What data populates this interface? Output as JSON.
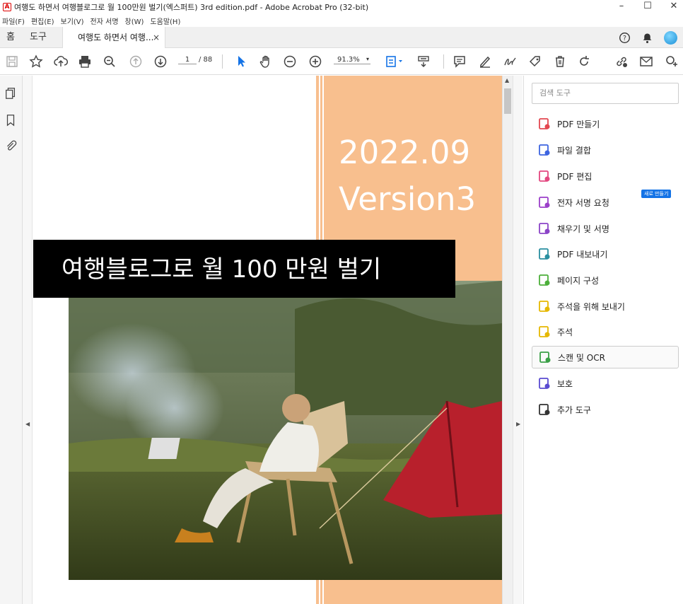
{
  "window": {
    "title": "여행도 하면서 여행블로그로 월 100만원 벌기(엑스퍼트) 3rd edition.pdf - Adobe Acrobat Pro (32-bit)",
    "app_icon": "pdf-icon",
    "controls": [
      "–",
      "☐",
      "✕"
    ]
  },
  "menu": [
    "파일(F)",
    "편집(E)",
    "보기(V)",
    "전자 서명",
    "창(W)",
    "도움말(H)"
  ],
  "tabs": {
    "home": "홈",
    "tools": "도구",
    "doc": "여행도 하면서 여행...",
    "close": "×"
  },
  "toolbar": {
    "page_current": "1",
    "page_total": "/ 88",
    "zoom": "91.3%"
  },
  "document": {
    "date_line": "2022.09",
    "version_line": "Version3",
    "cover_title": "여행블로그로 월 100 만원 벌기",
    "accent_color": "#f8bf8e"
  },
  "right_pane": {
    "search_placeholder": "검색 도구",
    "new_badge": "새로 만들기",
    "tools": [
      {
        "label": "PDF 만들기",
        "icon": "create-pdf-icon",
        "color": "#e34850"
      },
      {
        "label": "파일 결합",
        "icon": "combine-files-icon",
        "color": "#3d64e0"
      },
      {
        "label": "PDF 편집",
        "icon": "edit-pdf-icon",
        "color": "#e34880"
      },
      {
        "label": "전자 서명 요청",
        "icon": "request-signature-icon",
        "color": "#9b3fc9"
      },
      {
        "label": "채우기 및 서명",
        "icon": "fill-sign-icon",
        "color": "#8b44c7"
      },
      {
        "label": "PDF 내보내기",
        "icon": "export-pdf-icon",
        "color": "#2a8fa0"
      },
      {
        "label": "페이지 구성",
        "icon": "organize-pages-icon",
        "color": "#4caf3a"
      },
      {
        "label": "주석을 위해 보내기",
        "icon": "send-comments-icon",
        "color": "#e6b800"
      },
      {
        "label": "주석",
        "icon": "comment-icon",
        "color": "#e6b800"
      },
      {
        "label": "스캔 및 OCR",
        "icon": "scan-ocr-icon",
        "color": "#3aa047"
      },
      {
        "label": "보호",
        "icon": "protect-icon",
        "color": "#5a4bd1"
      },
      {
        "label": "추가 도구",
        "icon": "more-tools-icon",
        "color": "#333333"
      }
    ]
  }
}
